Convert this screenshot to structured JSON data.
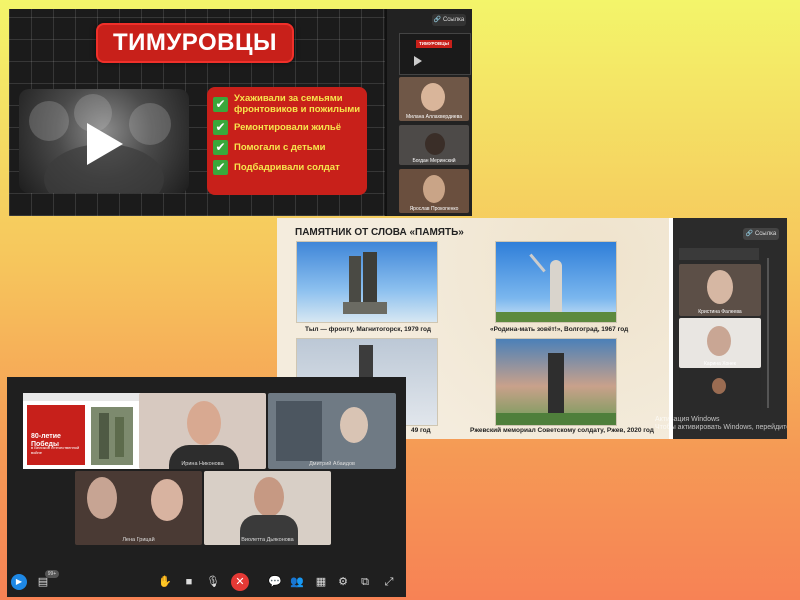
{
  "screen1": {
    "slide_title": "ТИМУРОВЦЫ",
    "items": [
      "Ухаживали за семьями фронтовиков и пожилыми",
      "Ремонтировали жильё",
      "Помогали с детьми",
      "Подбадривали солдат"
    ],
    "link_button": "Ссылка",
    "participants": [
      "Милана Аллахвердиева",
      "Богдан Меринский",
      "Ярослав Прокопенко"
    ],
    "accent": "#c8201a"
  },
  "screen2": {
    "slide_title": "ПАМЯТНИК ОТ СЛОВА «ПАМЯТЬ»",
    "captions": [
      "Тыл — фронту, Магнитогорск, 1979 год",
      "«Родина-мать зовёт!», Волгоград, 1967 год",
      "49 год",
      "Ржевский мемориал Советскому солдату, Ржев, 2020 год"
    ],
    "link_button": "Ссылка",
    "participants": [
      "Кристина Фалеева",
      "Карина Хонек",
      ""
    ],
    "watermark_line1": "Активация Windows",
    "watermark_line2": "Чтобы активировать Windows, перейдите в"
  },
  "screen3": {
    "shared_title": "80-летие Победы",
    "shared_subtitle": "в Великой Отечественной войне",
    "participants": [
      "Ирина Никонова",
      "Дмитрий Абаидов",
      "Лена Грицай",
      "Виолетта Дьяконова"
    ],
    "badge": "99+"
  }
}
